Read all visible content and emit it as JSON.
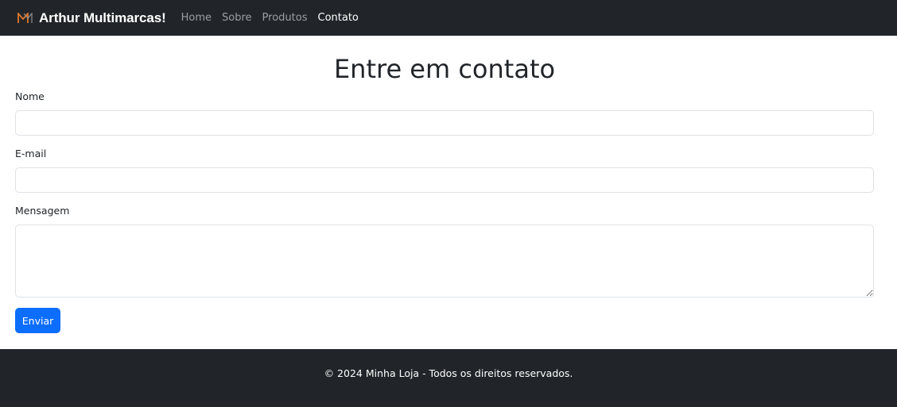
{
  "navbar": {
    "brand": "Arthur Multimarcas!",
    "logo_icon": "m-logo-icon",
    "logo_color": "#e0762a",
    "links": [
      {
        "label": "Home",
        "active": false
      },
      {
        "label": "Sobre",
        "active": false
      },
      {
        "label": "Produtos",
        "active": false
      },
      {
        "label": "Contato",
        "active": true
      }
    ]
  },
  "main": {
    "title": "Entre em contato",
    "fields": {
      "name_label": "Nome",
      "name_value": "",
      "email_label": "E-mail",
      "email_value": "",
      "message_label": "Mensagem",
      "message_value": ""
    },
    "submit_label": "Enviar"
  },
  "footer": {
    "text": "© 2024 Minha Loja - Todos os direitos reservados."
  },
  "colors": {
    "navbar_bg": "#212529",
    "primary": "#0d6efd",
    "input_border": "#dee2e6"
  }
}
